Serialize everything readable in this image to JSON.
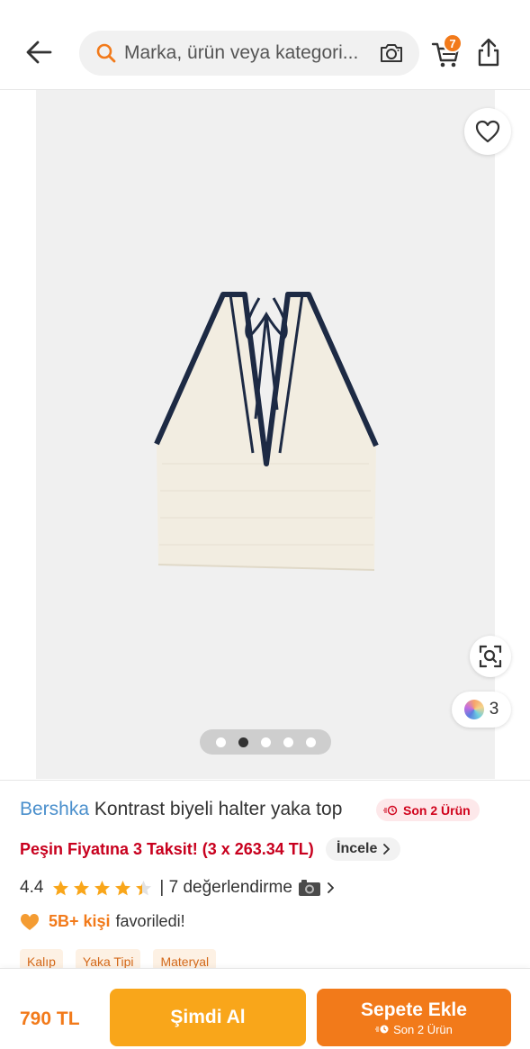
{
  "header": {
    "back_icon": "arrow-left-icon",
    "search_placeholder": "Marka, ürün veya kategori...",
    "search_icon": "search-icon",
    "camera_icon": "camera-icon",
    "cart_icon": "cart-icon",
    "cart_count": "7",
    "share_icon": "share-icon"
  },
  "gallery": {
    "favorite_icon": "heart-icon",
    "visual_search_icon": "visual-search-icon",
    "color_count": "3",
    "image_count": 5,
    "active_index": 1
  },
  "product": {
    "brand": "Bershka",
    "name": "Kontrast biyeli halter yaka top",
    "stock_badge": "Son 2 Ürün",
    "installment_text": "Peşin Fiyatına 3 Taksit! (3 x 263.34 TL)",
    "incele_label": "İncele",
    "rating": "4.4",
    "rating_value": 4.4,
    "rating_max": 5,
    "review_text": "| 7 değerlendirme",
    "favorite_count": "5B+ kişi",
    "favorite_text": "favoriledi!",
    "attributes": [
      "Kalıp",
      "Yaka Tipi",
      "Materyal"
    ]
  },
  "bottom": {
    "price": "790 TL",
    "buy_label": "Şimdi Al",
    "add_to_cart_label": "Sepete Ekle",
    "add_to_cart_sub": "Son 2 Ürün"
  },
  "colors": {
    "accent": "#f27a1a",
    "buy_button": "#f9a61a",
    "brand_link": "#4a8fcc",
    "installment": "#c8001e",
    "star": "#f9a61a"
  }
}
